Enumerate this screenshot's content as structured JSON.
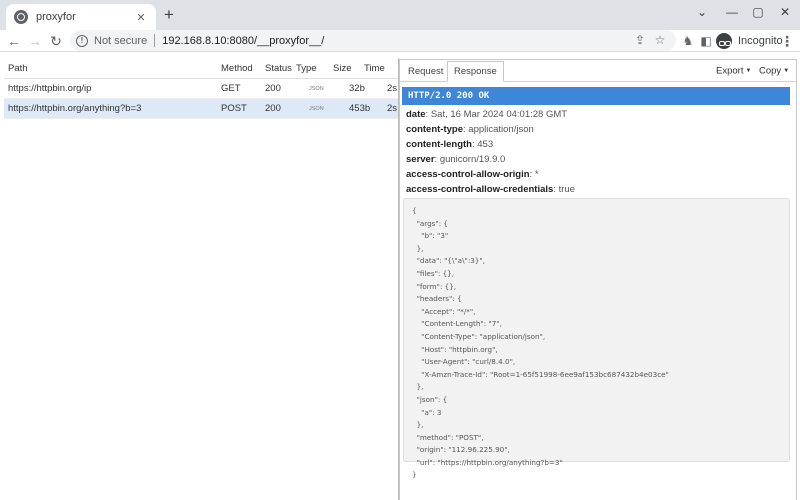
{
  "browser": {
    "tab_title": "proxyfor",
    "tab_close": "✕",
    "new_tab": "+",
    "security_label": "Not secure",
    "url": "192.168.8.10:8080/__proxyfor__/",
    "incognito_label": "Incognito"
  },
  "requests": {
    "columns": {
      "path": "Path",
      "method": "Method",
      "status": "Status",
      "type": "Type",
      "size": "Size",
      "time": "Time"
    },
    "rows": [
      {
        "path": "https://httpbin.org/ip",
        "method": "GET",
        "status": "200",
        "type": "JSON",
        "size": "32b",
        "time": "2s"
      },
      {
        "path": "https://httpbin.org/anything?b=3",
        "method": "POST",
        "status": "200",
        "type": "JSON",
        "size": "453b",
        "time": "2s"
      }
    ]
  },
  "detail": {
    "tabs": {
      "request": "Request",
      "response": "Response"
    },
    "export_label": "Export",
    "copy_label": "Copy",
    "status_line": "HTTP/2.0 200 OK",
    "headers": [
      {
        "key": "date",
        "value": "Sat, 16 Mar 2024 04:01:28 GMT"
      },
      {
        "key": "content-type",
        "value": "application/json"
      },
      {
        "key": "content-length",
        "value": "453"
      },
      {
        "key": "server",
        "value": "gunicorn/19.9.0"
      },
      {
        "key": "access-control-allow-origin",
        "value": "*"
      },
      {
        "key": "access-control-allow-credentials",
        "value": "true"
      }
    ],
    "body": "{\n  \"args\": {\n    \"b\": \"3\"\n  },\n  \"data\": \"{\\\"a\\\":3}\",\n  \"files\": {},\n  \"form\": {},\n  \"headers\": {\n    \"Accept\": \"*/*\",\n    \"Content-Length\": \"7\",\n    \"Content-Type\": \"application/json\",\n    \"Host\": \"httpbin.org\",\n    \"User-Agent\": \"curl/8.4.0\",\n    \"X-Amzn-Trace-Id\": \"Root=1-65f51998-6ee9af153bc687432b4e03ce\"\n  },\n  \"json\": {\n    \"a\": 3\n  },\n  \"method\": \"POST\",\n  \"origin\": \"112.96.225.90\",\n  \"url\": \"https://httpbin.org/anything?b=3\"\n}"
  }
}
